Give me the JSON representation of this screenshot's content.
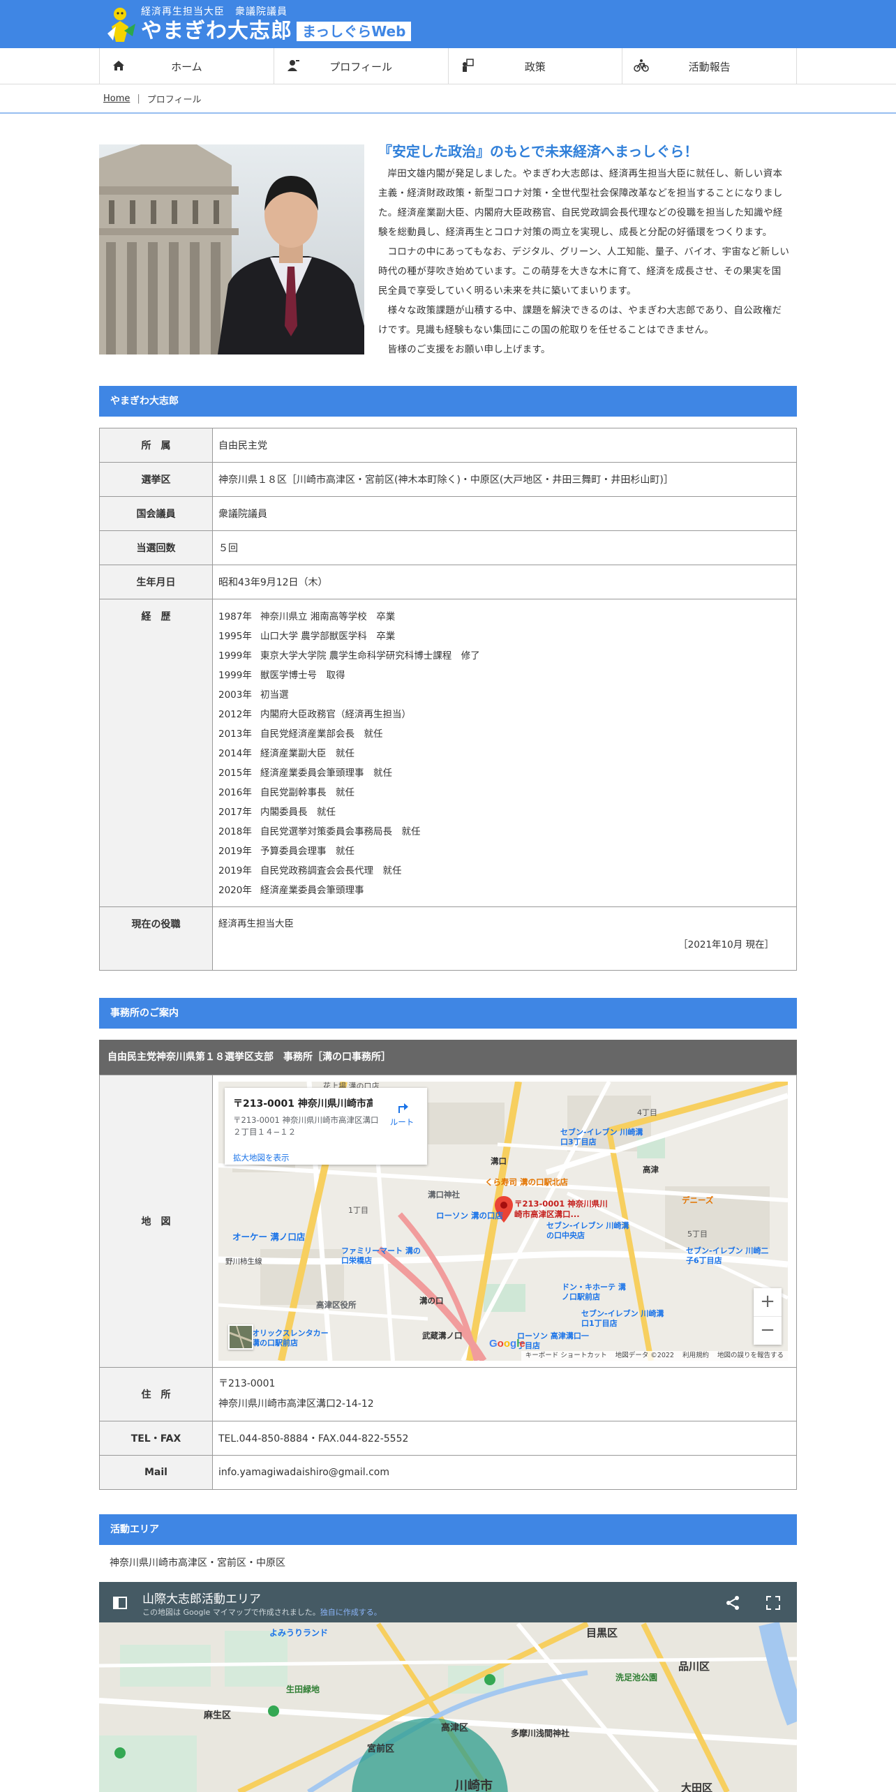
{
  "header": {
    "subtitle": "経済再生担当大臣　衆議院議員",
    "name": "やまぎわ大志郎",
    "badge": "まっしぐらWeb"
  },
  "nav": {
    "items": [
      {
        "label": "ホーム",
        "icon": "home-icon"
      },
      {
        "label": "プロフィール",
        "icon": "profile-icon"
      },
      {
        "label": "政策",
        "icon": "policy-icon"
      },
      {
        "label": "活動報告",
        "icon": "bicycle-icon"
      }
    ]
  },
  "breadcrumb": {
    "home": "Home",
    "current": "プロフィール"
  },
  "intro": {
    "title": "『安定した政治』のもとで未来経済へまっしぐら！",
    "paragraphs": [
      "岸田文雄内閣が発足しました。やまぎわ大志郎は、経済再生担当大臣に就任し、新しい資本主義・経済財政政策・新型コロナ対策・全世代型社会保障改革などを担当することになりました。経済産業副大臣、内閣府大臣政務官、自民党政調会長代理などの役職を担当した知識や経験を総動員し、経済再生とコロナ対策の両立を実現し、成長と分配の好循環をつくります。",
      "コロナの中にあってもなお、デジタル、グリーン、人工知能、量子、バイオ、宇宙など新しい時代の種が芽吹き始めています。この萌芽を大きな木に育て、経済を成長させ、その果実を国民全員で享受していく明るい未来を共に築いてまいります。",
      "様々な政策課題が山積する中、課題を解決できるのは、やまぎわ大志郎であり、自公政権だけです。見識も経験もない集団にこの国の舵取りを任せることはできません。",
      "皆様のご支援をお願い申し上げます。"
    ]
  },
  "profile": {
    "section_title": "やまぎわ大志郎",
    "rows": {
      "party_label": "所　属",
      "party": "自由民主党",
      "district_label": "選挙区",
      "district": "神奈川県１８区［川崎市高津区・宮前区(神木本町除く)・中原区(大戸地区・井田三舞町・井田杉山町)］",
      "diet_label": "国会議員",
      "diet": "衆議院議員",
      "wins_label": "当選回数",
      "wins": "５回",
      "birth_label": "生年月日",
      "birth": "昭和43年9月12日（木）",
      "career_label": "経　歴",
      "position_label": "現在の役職",
      "position": "経済再生担当大臣",
      "position_date": "［2021年10月 現在］"
    },
    "career": [
      {
        "year": "1987年",
        "text": "神奈川県立 湘南高等学校　卒業"
      },
      {
        "year": "1995年",
        "text": "山口大学 農学部獣医学科　卒業"
      },
      {
        "year": "1999年",
        "text": "東京大学大学院 農学生命科学研究科博士課程　修了"
      },
      {
        "year": "1999年",
        "text": "獣医学博士号　取得"
      },
      {
        "year": "2003年",
        "text": "初当選"
      },
      {
        "year": "2012年",
        "text": "内閣府大臣政務官（経済再生担当）"
      },
      {
        "year": "2013年",
        "text": "自民党経済産業部会長　就任"
      },
      {
        "year": "2014年",
        "text": "経済産業副大臣　就任"
      },
      {
        "year": "2015年",
        "text": "経済産業委員会筆頭理事　就任"
      },
      {
        "year": "2016年",
        "text": "自民党副幹事長　就任"
      },
      {
        "year": "2017年",
        "text": "内閣委員長　就任"
      },
      {
        "year": "2018年",
        "text": "自民党選挙対策委員会事務局長　就任"
      },
      {
        "year": "2019年",
        "text": "予算委員会理事　就任"
      },
      {
        "year": "2019年",
        "text": "自民党政務調査会会長代理　就任"
      },
      {
        "year": "2020年",
        "text": "経済産業委員会筆頭理事"
      }
    ]
  },
  "office": {
    "section_title": "事務所のご案内",
    "office_name": "自由民主党神奈川県第１８選挙区支部　事務所［溝の口事務所］",
    "map_label": "地　図",
    "address_label": "住　所",
    "postal": "〒213-0001",
    "address": "神奈川県川崎市高津区溝口2-14-12",
    "tel_label": "TEL・FAX",
    "tel": "TEL.044-850-8884・FAX.044-822-5552",
    "mail_label": "Mail",
    "mail": "info.yamagiwadaishiro@gmail.com",
    "map": {
      "card_title": "〒213-0001 神奈川県川崎市高...",
      "card_address": "〒213-0001 神奈川県川崎市高津区溝口２丁目１４−１２",
      "card_link": "拡大地図を表示",
      "card_route": "ルート",
      "pin_label": "〒213-0001 神奈川県川崎市高津区溝口...",
      "footer": [
        "キーボード ショートカット",
        "地図データ ©2022",
        "利用規約",
        "地図の誤りを報告する"
      ],
      "places": [
        "セブン-イレブン 川崎溝口3丁目店",
        "くら寿司 溝の口駅北店",
        "溝口神社",
        "ローソン 溝の口店",
        "オーケー 溝ノ口店",
        "ファミリーマート 溝の口栄橋店",
        "セブン-イレブン 川崎溝の口中央店",
        "セブン-イレブン 川崎二子6丁目店",
        "ドン・キホーテ 溝ノ口駅前店",
        "セブン-イレブン 川崎溝口1丁目店",
        "高津区役所",
        "オリックスレンタカー 溝の口駅前店",
        "ローソン 高津溝口一丁目店",
        "デニーズ",
        "溝の口",
        "武蔵溝ノ口",
        "野川柿生線",
        "高津",
        "溝口",
        "4丁目",
        "5丁目",
        "1丁目",
        "花上場 溝の口店"
      ]
    }
  },
  "area": {
    "section_title": "活動エリア",
    "text": "神奈川県川崎市高津区・宮前区・中原区",
    "map_title": "山際大志郎活動エリア",
    "map_note_prefix": "この地図は Google マイマップで作成されました。",
    "map_note_link": "独自に作成する。",
    "places": [
      "目黒区",
      "品川区",
      "大田区",
      "生田緑地",
      "高津区",
      "宮前区",
      "麻生区",
      "川崎市",
      "よみうりランド",
      "洗足池公園",
      "多摩川浅間神社"
    ]
  },
  "colors": {
    "primary": "#3f86e4",
    "office_head": "#676767",
    "mymap_bar": "#455a64"
  }
}
